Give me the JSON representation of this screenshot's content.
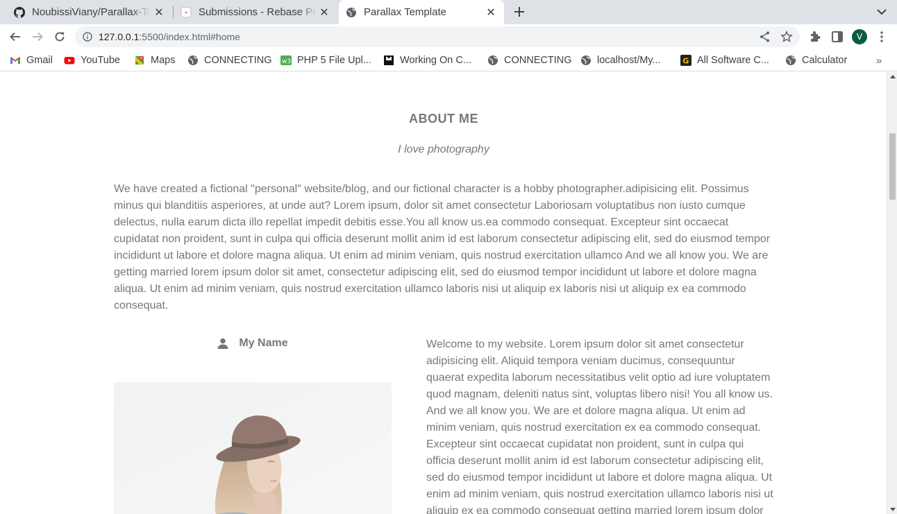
{
  "browser": {
    "tabs": [
      {
        "title": "NoubissiViany/Parallax-Te",
        "icon": "github-icon",
        "active": false
      },
      {
        "title": "Submissions - Rebase Port",
        "icon": "page-icon",
        "active": false
      },
      {
        "title": "Parallax Template",
        "icon": "globe-icon",
        "active": true
      }
    ],
    "url_host": "127.0.0.1",
    "url_rest": ":5500/index.html#home",
    "profile_initial": "V",
    "bookmarks": [
      {
        "label": "Gmail",
        "icon": "gmail-icon"
      },
      {
        "label": "YouTube",
        "icon": "youtube-icon"
      },
      {
        "label": "Maps",
        "icon": "maps-icon"
      },
      {
        "label": "CONNECTING",
        "icon": "globe-icon"
      },
      {
        "label": "PHP 5 File Upl...",
        "icon": "w3-icon"
      },
      {
        "label": "Working On C...",
        "icon": "bookmark-icon"
      },
      {
        "label": "CONNECTING",
        "icon": "globe-icon"
      },
      {
        "label": "localhost/My...",
        "icon": "globe-icon"
      },
      {
        "label": "All Software C...",
        "icon": "g-icon"
      },
      {
        "label": "Calculator",
        "icon": "globe-icon"
      }
    ],
    "bookmarks_more": "»"
  },
  "page": {
    "about_heading": "ABOUT ME",
    "about_subheading": "I love photography",
    "about_paragraph": "We have created a fictional \"personal\" website/blog, and our fictional character is a hobby photographer.adipisicing elit. Possimus minus qui blanditiis asperiores, at unde aut? Lorem ipsum, dolor sit amet consectetur Laboriosam voluptatibus non iusto cumque delectus, nulla earum dicta illo repellat impedit debitis esse.You all know us.ea commodo consequat. Excepteur sint occaecat cupidatat non proident, sunt in culpa qui officia deserunt mollit anim id est laborum consectetur adipiscing elit, sed do eiusmod tempor incididunt ut labore et dolore magna aliqua. Ut enim ad minim veniam, quis nostrud exercitation ullamco And we all know you. We are getting married lorem ipsum dolor sit amet, consectetur adipiscing elit, sed do eiusmod tempor incididunt ut labore et dolore magna aliqua. Ut enim ad minim veniam, quis nostrud exercitation ullamco laboris nisi ut aliquip ex laboris nisi ut aliquip ex ea commodo consequat.",
    "name_label": "My Name",
    "welcome_paragraph": "Welcome to my website. Lorem ipsum dolor sit amet consectetur adipisicing elit. Aliquid tempora veniam ducimus, consequuntur quaerat expedita laborum necessitatibus velit optio ad iure voluptatem quod magnam, deleniti natus sint, voluptas libero nisi! You all know us. And we all know you. We are et dolore magna aliqua. Ut enim ad minim veniam, quis nostrud exercitation ex ea commodo consequat. Excepteur sint occaecat cupidatat non proident, sunt in culpa qui officia deserunt mollit anim id est laborum consectetur adipiscing elit, sed do eiusmod tempor incididunt ut labore et dolore magna aliqua. Ut enim ad minim veniam, quis nostrud exercitation ullamco laboris nisi ut aliquip ex ea commodo consequat getting married lorem ipsum dolor"
  },
  "colors": {
    "text": "#777777",
    "tabstrip": "#dee1e6",
    "profile": "#0d5c3f"
  }
}
